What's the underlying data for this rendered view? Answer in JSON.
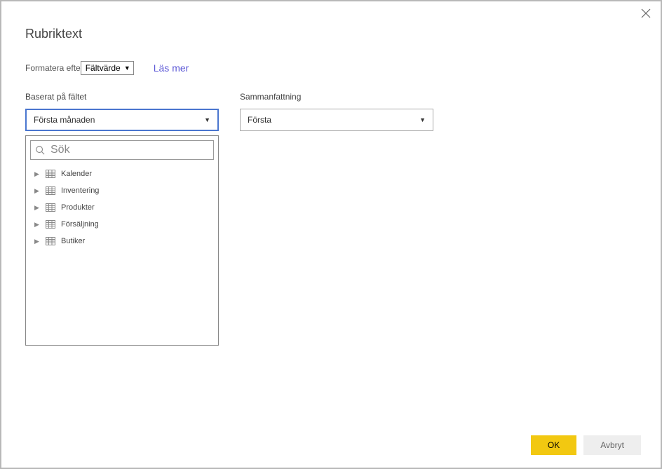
{
  "dialog": {
    "title": "Rubriktext"
  },
  "format": {
    "label": "Formatera efter",
    "selected": "Fältvärde"
  },
  "learnMore": "Läs mer",
  "basedOn": {
    "label": "Baserat på fältet",
    "selected": "Första månaden"
  },
  "summary": {
    "label": "Sammanfattning",
    "selected": "Första"
  },
  "search": {
    "placeholder": "Sök"
  },
  "tree": {
    "items": [
      {
        "label": "Kalender"
      },
      {
        "label": "Inventering"
      },
      {
        "label": "Produkter"
      },
      {
        "label": "Försäljning"
      },
      {
        "label": "Butiker"
      }
    ]
  },
  "buttons": {
    "ok": "OK",
    "cancel": "Avbryt"
  }
}
